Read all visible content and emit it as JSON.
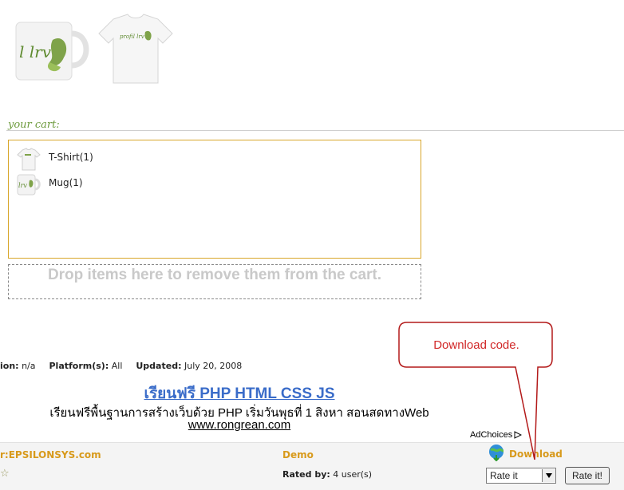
{
  "products": {
    "mug_logo": "l lrv",
    "shirt_logo": "profil lrv"
  },
  "cart": {
    "title": "your cart:",
    "items": [
      {
        "label": "T-Shirt(1)",
        "icon": "tshirt-thumbnail"
      },
      {
        "label": "Mug(1)",
        "icon": "mug-thumbnail"
      }
    ],
    "drop_zone_text": "Drop items here to remove them from the cart."
  },
  "meta": {
    "version_label": "ion:",
    "version_value": "n/a",
    "platform_label": "Platform(s):",
    "platform_value": "All",
    "updated_label": "Updated:",
    "updated_value": "July 20, 2008"
  },
  "ad": {
    "title": "เรียนฟรี PHP HTML CSS JS",
    "text": "เรียนฟรีพื้นฐานการสร้างเว็บด้วย PHP เริ่มวันพุธที่ 1 สิงหา สอนสดทางWeb",
    "url": "www.rongrean.com",
    "adchoices": "AdChoices"
  },
  "callout": {
    "text": "Download code."
  },
  "footer": {
    "author": "r:EPSILONSYS.com",
    "demo": "Demo",
    "download": "Download",
    "rated_label": "Rated by:",
    "rated_value": "4 user(s)",
    "rate_select_value": "Rate it",
    "rate_button": "Rate it!"
  },
  "colors": {
    "accent_orange": "#d89a1c",
    "cart_green": "#6c9a3b",
    "callout_red": "#d12727",
    "ad_link_blue": "#3a6cc9"
  }
}
